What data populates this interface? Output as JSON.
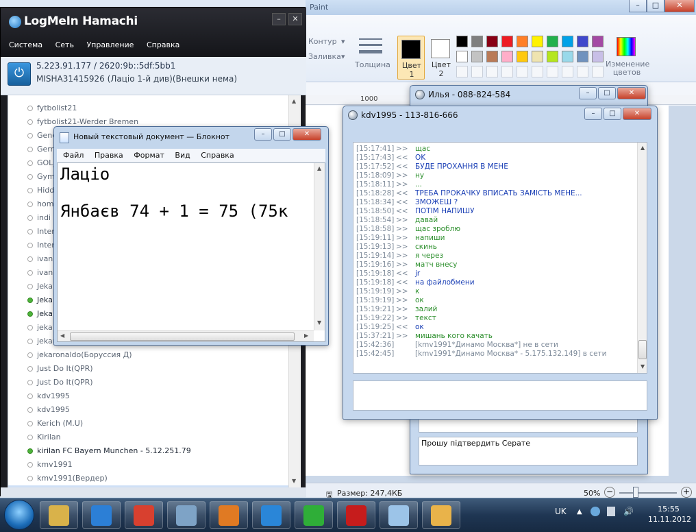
{
  "paint": {
    "title": "Paint",
    "ribbon": {
      "outline_label": "Контур",
      "fill_label": "Заливка",
      "thickness_label": "Толщина",
      "color1_label": "Цвет 1",
      "color2_label": "Цвет 2",
      "edit_colors_label": "Изменение цветов",
      "palette_row1": [
        "#000000",
        "#7f7f7f",
        "#880015",
        "#ed1c24",
        "#ff7f27",
        "#fff200",
        "#22b14c",
        "#00a2e8",
        "#3f48cc",
        "#a349a4"
      ],
      "palette_row2": [
        "#ffffff",
        "#c3c3c3",
        "#b97a57",
        "#ffaec9",
        "#ffc90e",
        "#efe4b0",
        "#b5e61d",
        "#99d9ea",
        "#7092be",
        "#c8bfe7"
      ]
    },
    "ruler_value": "1000",
    "status_size": "Размер: 247,4КБ",
    "zoom": "50%"
  },
  "hamachi": {
    "logo": "LogMeIn Hamachi",
    "menu": [
      "Система",
      "Сеть",
      "Управление",
      "Справка"
    ],
    "ip": "5.223.91.177 / 2620:9b::5df:5bb1",
    "user": "MISHA31415926 (Лаціо 1-й див)(Внешки нема)",
    "peers": [
      {
        "name": "fytbolist21",
        "online": false
      },
      {
        "name": "fytbolist21-Werder Bremen",
        "online": false
      },
      {
        "name": "Gene",
        "online": false
      },
      {
        "name": "Gerra",
        "online": false
      },
      {
        "name": "GOL_",
        "online": false
      },
      {
        "name": "Gymn",
        "online": false
      },
      {
        "name": "Hidde",
        "online": false
      },
      {
        "name": "home",
        "online": false
      },
      {
        "name": "indi",
        "online": false
      },
      {
        "name": "Inter",
        "online": false
      },
      {
        "name": "Inter",
        "online": false
      },
      {
        "name": "ivan(",
        "online": false
      },
      {
        "name": "ivanh",
        "online": false
      },
      {
        "name": "Jeka",
        "online": false
      },
      {
        "name": "Jeka",
        "online": true
      },
      {
        "name": "Jeka",
        "online": true
      },
      {
        "name": "jeka",
        "online": false
      },
      {
        "name": "jekar",
        "online": false
      },
      {
        "name": "jekaronaldo(Борусcия Д)",
        "online": false
      },
      {
        "name": "Just Do It(QPR)",
        "online": false
      },
      {
        "name": "Just Do It(QPR)",
        "online": false
      },
      {
        "name": "kdv1995",
        "online": false
      },
      {
        "name": "kdv1995",
        "online": false
      },
      {
        "name": "Kerich (M.U)",
        "online": false
      },
      {
        "name": "Kirilan",
        "online": false
      },
      {
        "name": "kirilan FC Bayern Munchen - 5.12.251.79",
        "online": true
      },
      {
        "name": "kmv1991",
        "online": false
      },
      {
        "name": "kmv1991(Вердер)",
        "online": false
      },
      {
        "name": "kmv1991*Динамо Москва* - 5.175.132.149",
        "online": true
      }
    ]
  },
  "notepad": {
    "title": "Новый текстовый документ — Блокнот",
    "menu": [
      "Файл",
      "Правка",
      "Формат",
      "Вид",
      "Справка"
    ],
    "line1": "Лаціо",
    "line2": "Янбаєв 74 + 1 = 75 (75к"
  },
  "chat_back": {
    "title": "Илья - 088-824-584",
    "input_text": "Прошу підтвердить Серате"
  },
  "chat_front": {
    "title": "kdv1995 - 113-816-666",
    "messages": [
      {
        "time": "[15:17:41]",
        "dir": ">>",
        "text": "щас",
        "kind": "out"
      },
      {
        "time": "[15:17:43]",
        "dir": "<<",
        "text": "OK",
        "kind": "in"
      },
      {
        "time": "[15:17:52]",
        "dir": "<<",
        "text": "БУДЕ ПРОХАННЯ В МЕНЕ",
        "kind": "in"
      },
      {
        "time": "[15:18:09]",
        "dir": ">>",
        "text": "ну",
        "kind": "out"
      },
      {
        "time": "[15:18:11]",
        "dir": ">>",
        "text": "...",
        "kind": "out"
      },
      {
        "time": "[15:18:28]",
        "dir": "<<",
        "text": "ТРЕБА ПРОКАЧКУ ВПИСАТЬ ЗАМІСТЬ МЕНЕ...",
        "kind": "in"
      },
      {
        "time": "[15:18:34]",
        "dir": "<<",
        "text": "ЗМОЖЕШ ?",
        "kind": "in"
      },
      {
        "time": "[15:18:50]",
        "dir": "<<",
        "text": "ПОТІМ НАПИШУ",
        "kind": "in"
      },
      {
        "time": "[15:18:54]",
        "dir": ">>",
        "text": "давай",
        "kind": "out"
      },
      {
        "time": "[15:18:58]",
        "dir": ">>",
        "text": "щас зроблю",
        "kind": "out"
      },
      {
        "time": "[15:19:11]",
        "dir": ">>",
        "text": "напиши",
        "kind": "out"
      },
      {
        "time": "[15:19:13]",
        "dir": ">>",
        "text": "скинь",
        "kind": "out"
      },
      {
        "time": "[15:19:14]",
        "dir": ">>",
        "text": "я через",
        "kind": "out"
      },
      {
        "time": "[15:19:16]",
        "dir": ">>",
        "text": "матч внесу",
        "kind": "out"
      },
      {
        "time": "[15:19:18]",
        "dir": "<<",
        "text": "jr",
        "kind": "in"
      },
      {
        "time": "[15:19:18]",
        "dir": "<<",
        "text": "на файлобмени",
        "kind": "in"
      },
      {
        "time": "[15:19:19]",
        "dir": ">>",
        "text": "к",
        "kind": "out"
      },
      {
        "time": "[15:19:19]",
        "dir": ">>",
        "text": "ок",
        "kind": "out"
      },
      {
        "time": "[15:19:21]",
        "dir": ">>",
        "text": "залий",
        "kind": "out"
      },
      {
        "time": "[15:19:22]",
        "dir": ">>",
        "text": "текст",
        "kind": "out"
      },
      {
        "time": "[15:19:25]",
        "dir": "<<",
        "text": "ок",
        "kind": "in"
      },
      {
        "time": "[15:37:21]",
        "dir": ">>",
        "text": "мишань кого качать",
        "kind": "out"
      },
      {
        "time": "[15:42:36]",
        "dir": "",
        "text": "[kmv1991*Динамо Москва*] не в сети",
        "kind": "sys"
      },
      {
        "time": "[15:42:45]",
        "dir": "",
        "text": "[kmv1991*Динамо Москва* - 5.175.132.149] в сети",
        "kind": "sys"
      }
    ]
  },
  "taskbar": {
    "lang": "UK",
    "time": "15:55",
    "date": "11.11.2012",
    "apps": [
      {
        "name": "explorer-icon",
        "color": "#d9b24a"
      },
      {
        "name": "ie-icon",
        "color": "#2c7fd6"
      },
      {
        "name": "chrome-icon",
        "color": "#d8402f"
      },
      {
        "name": "calculator-icon",
        "color": "#7ea3c6"
      },
      {
        "name": "media-icon",
        "color": "#e07a23"
      },
      {
        "name": "hamachi-icon",
        "color": "#2a86d8"
      },
      {
        "name": "player-icon",
        "color": "#2fae38"
      },
      {
        "name": "app07-icon",
        "color": "#c61c1c"
      },
      {
        "name": "notepad-icon",
        "color": "#9cc4e8"
      },
      {
        "name": "paint-icon",
        "color": "#e9b34a"
      }
    ]
  }
}
